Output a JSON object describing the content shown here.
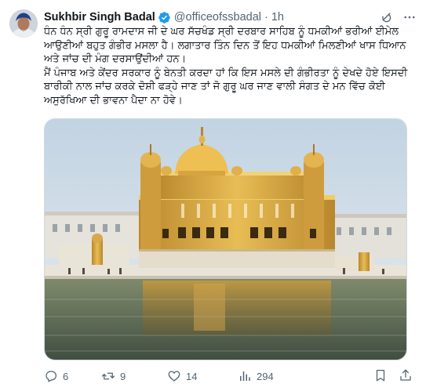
{
  "author": {
    "name": "Sukhbir Singh Badal",
    "handle": "@officeofssbadal",
    "separator": "·",
    "time": "1h",
    "verified": true,
    "verified_color": "#1d9bf0"
  },
  "header_icons": [
    "grok-icon",
    "more-icon"
  ],
  "post": {
    "text": "ਧੰਨ ਧੰਨ ਸ੍ਰੀ ਗੁਰੂ ਰਾਮਦਾਸ ਜੀ ਦੇ ਘਰ ਸੱਚਖੰਡ ਸ੍ਰੀ ਦਰਬਾਰ ਸਾਹਿਬ ਨੂੰ ਧਮਕੀਆਂ ਭਰੀਆਂ ਈਮੇਲ ਆਉਣੀਆਂ ਬਹੁਤ ਗੰਭੀਰ ਮਸਲਾ ਹੈ। ਲਗਾਤਾਰ ਤਿੰਨ ਦਿਨ ਤੋਂ ਇਹ ਧਮਕੀਆਂ ਮਿਲਣੀਆਂ ਖਾਸ ਧਿਆਨ ਅਤੇ ਜਾਂਚ ਦੀ ਮੰਗ ਦਰਸਾਉਂਦੀਆਂ ਹਨ।\nਮੈਂ ਪੰਜਾਬ ਅਤੇ ਕੇਂਦਰ ਸਰਕਾਰ ਨੂੰ ਬੇਨਤੀ ਕਰਦਾ ਹਾਂ ਕਿ ਇਸ ਮਸਲੇ ਦੀ ਗੰਭੀਰਤਾ ਨੂੰ ਦੇਖਦੇ ਹੋਏ ਇਸਦੀ ਬਾਰੀਕੀ ਨਾਲ ਜਾਂਚ ਕਰਕੇ ਦੋਸ਼ੀ ਫੜ੍ਹੇ ਜਾਣ ਤਾਂ ਜੋ ਗੁਰੂ ਘਰ ਜਾਣ ਵਾਲੀ ਸੰਗਤ ਦੇ ਮਨ ਵਿੱਚ ਕੋਈ ਅਸੁਰੱਖਿਆ ਦੀ ਭਾਵਨਾ ਪੈਦਾ ਨਾ ਹੋਵੇ।"
  },
  "media": {
    "subject": "golden-temple-photo"
  },
  "stats": {
    "replies": "6",
    "reposts": "9",
    "likes": "14",
    "views": "294"
  },
  "colors": {
    "text": "#0f1419",
    "muted": "#536471",
    "border": "#cfd9de"
  }
}
